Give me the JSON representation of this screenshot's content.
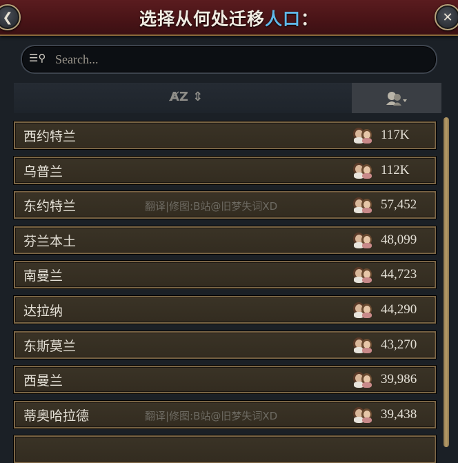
{
  "header": {
    "title_main": "选择从何处迁移",
    "title_highlight": "人口",
    "title_suffix": "：",
    "back_icon": "back-arrow-icon",
    "close_icon": "close-x-icon"
  },
  "search": {
    "placeholder": "Search...",
    "value": "",
    "icon": "search-filter-icon"
  },
  "sort": {
    "alpha_icon": "sort-alpha-icon",
    "pop_icon": "sort-population-icon",
    "active": "population"
  },
  "rows": [
    {
      "name": "西约特兰",
      "value": "117K",
      "watermark": ""
    },
    {
      "name": "乌普兰",
      "value": "112K",
      "watermark": ""
    },
    {
      "name": "东约特兰",
      "value": "57,452",
      "watermark": "翻译|修图:B站@旧梦失词XD"
    },
    {
      "name": "芬兰本土",
      "value": "48,099",
      "watermark": ""
    },
    {
      "name": "南曼兰",
      "value": "44,723",
      "watermark": ""
    },
    {
      "name": "达拉纳",
      "value": "44,290",
      "watermark": ""
    },
    {
      "name": "东斯莫兰",
      "value": "43,270",
      "watermark": ""
    },
    {
      "name": "西曼兰",
      "value": "39,986",
      "watermark": ""
    },
    {
      "name": "蒂奥哈拉德",
      "value": "39,438",
      "watermark": "翻译|修图:B站@旧梦失词XD"
    },
    {
      "name": "",
      "value": "",
      "watermark": ""
    }
  ],
  "colors": {
    "header_bg": "#4a1417",
    "highlight": "#5fb7e8",
    "row_bg": "#3a3326",
    "row_border": "#7a6545",
    "text": "#e4e0d6"
  }
}
